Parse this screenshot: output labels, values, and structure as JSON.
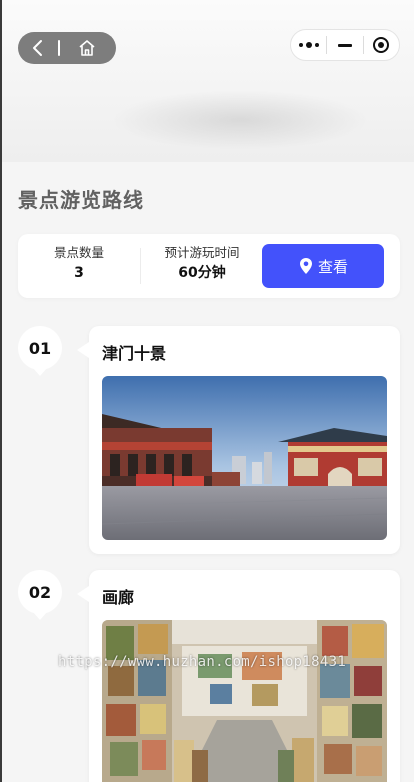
{
  "page": {
    "title": "景点游览路线"
  },
  "summary": {
    "spot_count_label": "景点数量",
    "spot_count_value": "3",
    "duration_label": "预计游玩时间",
    "duration_value": "60分钟",
    "view_button_label": "查看",
    "view_button_icon": "location-pin-icon",
    "accent_color": "#4352fb"
  },
  "header": {
    "back_icon": "chevron-left-icon",
    "home_icon": "home-icon",
    "more_icon": "more-dots-icon",
    "minimize_icon": "minimize-icon",
    "close_icon": "target-close-icon"
  },
  "spots": [
    {
      "index": "01",
      "name": "津门十景",
      "photo": "津门十景 photo"
    },
    {
      "index": "02",
      "name": "画廊",
      "photo": "画廊 photo"
    }
  ],
  "watermark": "https://www.huzhan.com/ishop18431"
}
